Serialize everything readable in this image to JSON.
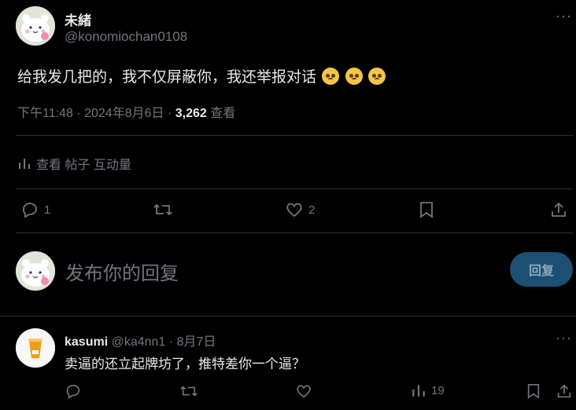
{
  "main_post": {
    "display_name": "未緒",
    "handle": "@konomiochan0108",
    "more": "···",
    "text": "给我发几把的，我不仅屏蔽你，我还举报对话",
    "time": "下午11:48",
    "sep": "·",
    "date": "2024年8月6日",
    "views_count": "3,262",
    "views_label": "查看",
    "activity": "查看 帖子 互动量",
    "replies": "1",
    "likes": "2"
  },
  "composer": {
    "placeholder": "发布你的回复",
    "reply_button": "回复"
  },
  "reply": {
    "display_name": "kasumi",
    "handle": "@ka4nn1",
    "sep": "·",
    "date": "8月7日",
    "more": "···",
    "text": "卖逼的还立起牌坊了，推特差你一个逼？",
    "views": "19"
  },
  "colors": {
    "background": "#000000",
    "text": "#e7e9ea",
    "muted": "#71767b",
    "divider": "#2f3336",
    "reply_button_bg": "#1d4f73"
  }
}
